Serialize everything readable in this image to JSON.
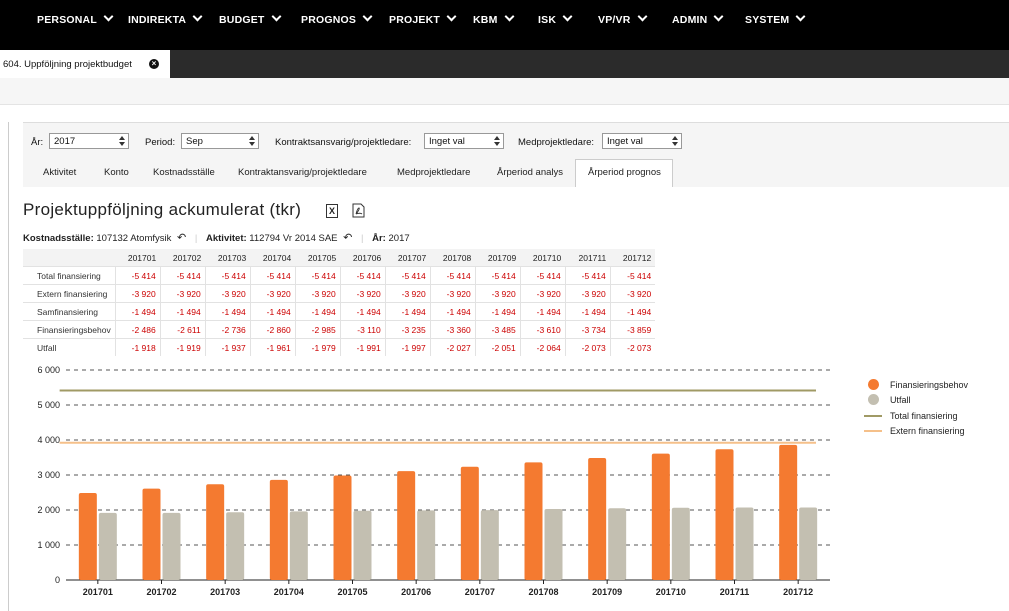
{
  "nav": {
    "items": [
      {
        "label": "PERSONAL"
      },
      {
        "label": "INDIREKTA"
      },
      {
        "label": "BUDGET"
      },
      {
        "label": "PROGNOS"
      },
      {
        "label": "PROJEKT"
      },
      {
        "label": "KBM"
      },
      {
        "label": "ISK"
      },
      {
        "label": "VP/VR"
      },
      {
        "label": "ADMIN"
      },
      {
        "label": "SYSTEM"
      }
    ]
  },
  "page_tab": {
    "label": "604. Uppföljning projektbudget",
    "close_icon": "close-icon"
  },
  "filters": {
    "year_label": "År:",
    "year_value": "2017",
    "period_label": "Period:",
    "period_value": "Sep",
    "contract_label": "Kontraktsansvarig/projektledare:",
    "contract_value": "Inget val",
    "co_label": "Medprojektledare:",
    "co_value": "Inget val"
  },
  "subtabs": [
    {
      "label": "Aktivitet"
    },
    {
      "label": "Konto"
    },
    {
      "label": "Kostnadsställe"
    },
    {
      "label": "Kontraktansvarig/projektledare"
    },
    {
      "label": "Medprojektledare"
    },
    {
      "label": "Årperiod analys"
    },
    {
      "label": "Årperiod prognos"
    }
  ],
  "active_subtab": "Årperiod prognos",
  "title": "Projektuppföljning ackumulerat (tkr)",
  "icons": {
    "excel": "excel-icon",
    "pdf": "pdf-icon",
    "undo": "undo-icon"
  },
  "crumbs": {
    "cost_label": "Kostnadsställe:",
    "cost_value": "107132 Atomfysik",
    "activity_label": "Aktivitet:",
    "activity_value": "112794 Vr 2014 SAE",
    "year_label": "År:",
    "year_value": "2017"
  },
  "table": {
    "columns": [
      "201701",
      "201702",
      "201703",
      "201704",
      "201705",
      "201706",
      "201707",
      "201708",
      "201709",
      "201710",
      "201711",
      "201712"
    ],
    "rows": [
      {
        "label": "Total finansiering",
        "values": [
          "-5 414",
          "-5 414",
          "-5 414",
          "-5 414",
          "-5 414",
          "-5 414",
          "-5 414",
          "-5 414",
          "-5 414",
          "-5 414",
          "-5 414",
          "-5 414"
        ]
      },
      {
        "label": "Extern finansiering",
        "values": [
          "-3 920",
          "-3 920",
          "-3 920",
          "-3 920",
          "-3 920",
          "-3 920",
          "-3 920",
          "-3 920",
          "-3 920",
          "-3 920",
          "-3 920",
          "-3 920"
        ]
      },
      {
        "label": "Samfinansiering",
        "values": [
          "-1 494",
          "-1 494",
          "-1 494",
          "-1 494",
          "-1 494",
          "-1 494",
          "-1 494",
          "-1 494",
          "-1 494",
          "-1 494",
          "-1 494",
          "-1 494"
        ]
      },
      {
        "label": "Finansieringsbehov",
        "values": [
          "-2 486",
          "-2 611",
          "-2 736",
          "-2 860",
          "-2 985",
          "-3 110",
          "-3 235",
          "-3 360",
          "-3 485",
          "-3 610",
          "-3 734",
          "-3 859"
        ]
      },
      {
        "label": "Utfall",
        "values": [
          "-1 918",
          "-1 919",
          "-1 937",
          "-1 961",
          "-1 979",
          "-1 991",
          "-1 997",
          "-2 027",
          "-2 051",
          "-2 064",
          "-2 073",
          "-2 073"
        ]
      }
    ]
  },
  "chart_data": {
    "type": "bar",
    "categories": [
      "201701",
      "201702",
      "201703",
      "201704",
      "201705",
      "201706",
      "201707",
      "201708",
      "201709",
      "201710",
      "201711",
      "201712"
    ],
    "series": [
      {
        "name": "Finansieringsbehov",
        "kind": "bar",
        "color": "#f47a30",
        "values": [
          2486,
          2611,
          2736,
          2860,
          2985,
          3110,
          3235,
          3360,
          3485,
          3610,
          3734,
          3859
        ]
      },
      {
        "name": "Utfall",
        "kind": "bar",
        "color": "#c3bfb1",
        "values": [
          1918,
          1919,
          1937,
          1961,
          1979,
          1991,
          1997,
          2027,
          2051,
          2064,
          2073,
          2073
        ]
      },
      {
        "name": "Total finansiering",
        "kind": "line",
        "color": "#a09a65",
        "values": [
          5414,
          5414,
          5414,
          5414,
          5414,
          5414,
          5414,
          5414,
          5414,
          5414,
          5414,
          5414
        ]
      },
      {
        "name": "Extern finansiering",
        "kind": "line",
        "color": "#f5c08a",
        "values": [
          3920,
          3920,
          3920,
          3920,
          3920,
          3920,
          3920,
          3920,
          3920,
          3920,
          3920,
          3920
        ]
      }
    ],
    "yticks": [
      "0",
      "1 000",
      "2 000",
      "3 000",
      "4 000",
      "5 000",
      "6 000"
    ],
    "ylim": [
      0,
      6000
    ],
    "grid": true,
    "legend": "right"
  },
  "colors": {
    "nav_bg": "#000000",
    "accent": "#f47a30",
    "negative": "#cc0000"
  }
}
